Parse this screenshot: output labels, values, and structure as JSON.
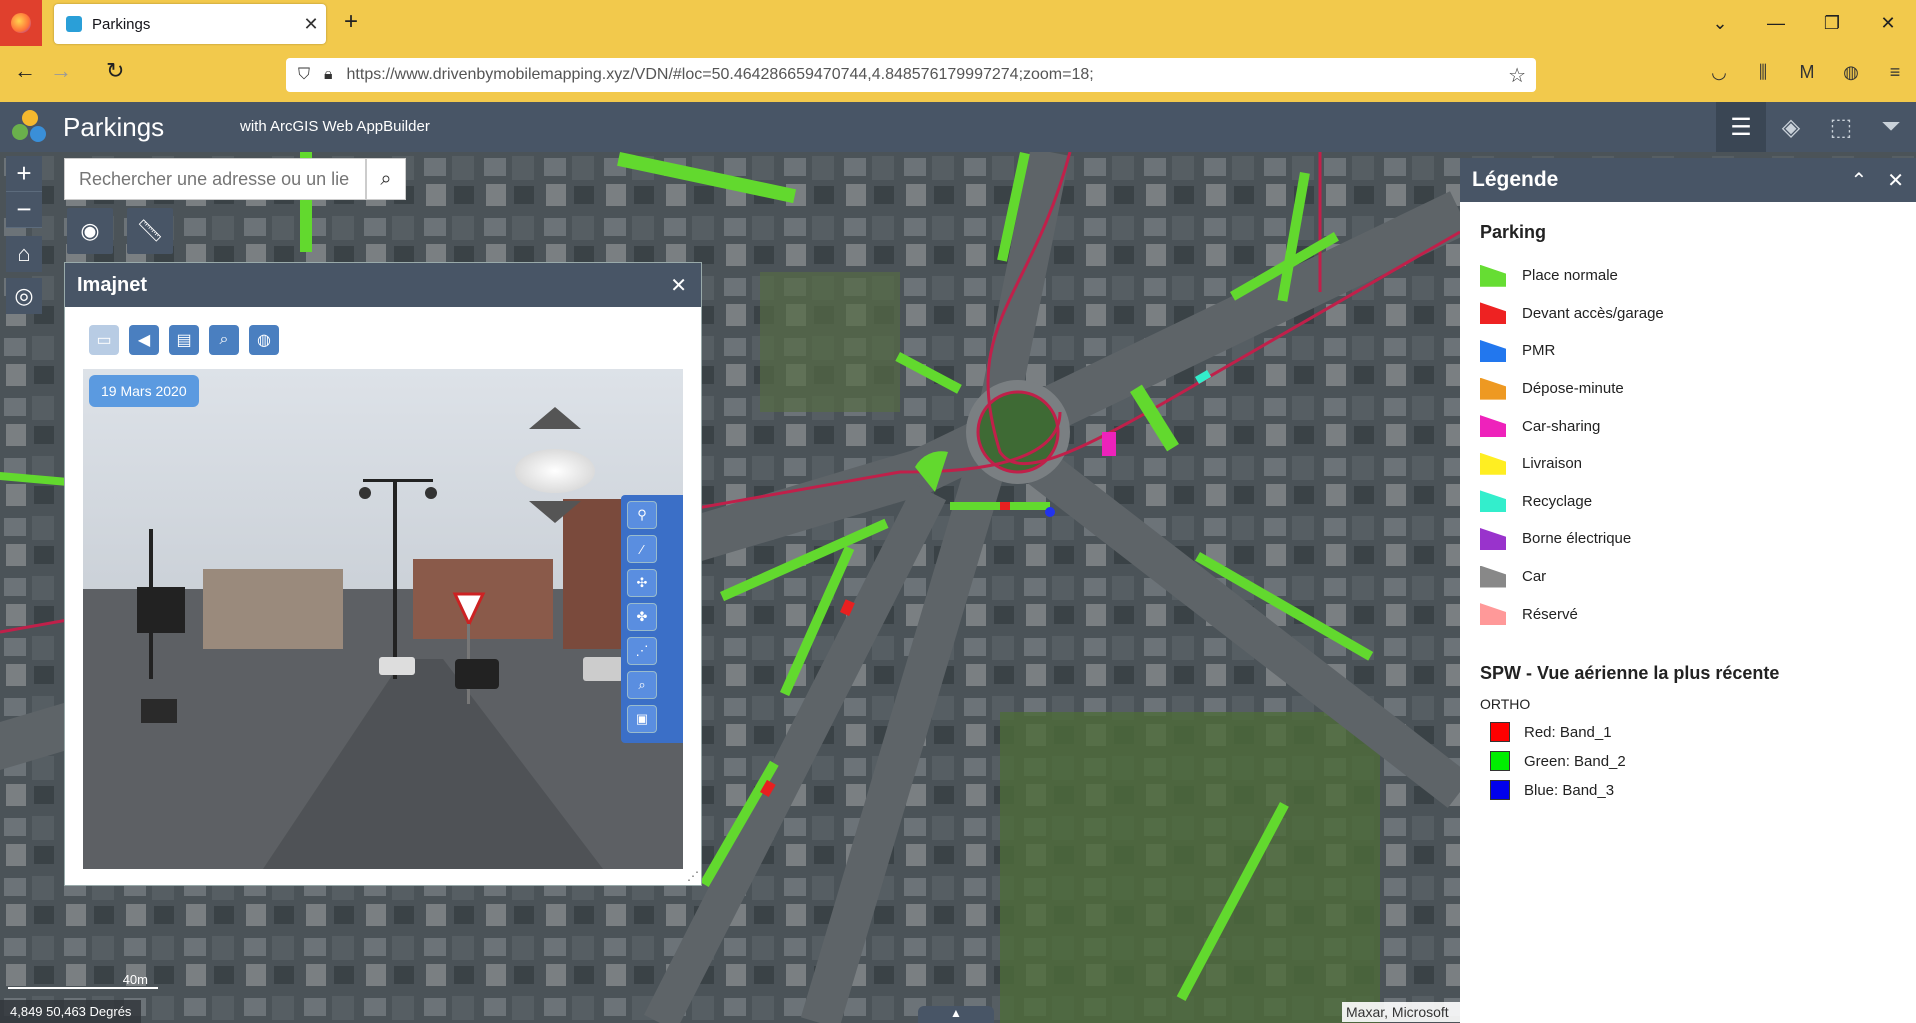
{
  "browser": {
    "tab_title": "Parkings",
    "url": "https://www.drivenbymobilemapping.xyz/VDN/#loc=50.464286659470744,4.848576179997274;zoom=18;"
  },
  "app": {
    "title": "Parkings",
    "subtitle": "with ArcGIS Web AppBuilder"
  },
  "search": {
    "placeholder": "Rechercher une adresse ou un lie"
  },
  "imajnet": {
    "title": "Imajnet",
    "date": "19 Mars 2020"
  },
  "legend": {
    "title": "Légende",
    "section1": "Parking",
    "items": [
      {
        "label": "Place normale",
        "color": "#66dd33"
      },
      {
        "label": "Devant accès/garage",
        "color": "#ee2222"
      },
      {
        "label": "PMR",
        "color": "#2277ee"
      },
      {
        "label": "Dépose-minute",
        "color": "#ee9922"
      },
      {
        "label": "Car-sharing",
        "color": "#ee22bb"
      },
      {
        "label": "Livraison",
        "color": "#ffee22"
      },
      {
        "label": "Recyclage",
        "color": "#33eecc"
      },
      {
        "label": "Borne électrique",
        "color": "#9933cc"
      },
      {
        "label": "Car",
        "color": "#888888"
      },
      {
        "label": "Réservé",
        "color": "#ff9999"
      }
    ],
    "section2": "SPW - Vue aérienne la plus récente",
    "sublabel": "ORTHO",
    "bands": [
      {
        "label": "Red: Band_1",
        "color": "#ff0000"
      },
      {
        "label": "Green: Band_2",
        "color": "#00ee00"
      },
      {
        "label": "Blue: Band_3",
        "color": "#0000ee"
      }
    ]
  },
  "map": {
    "scale_label": "40m",
    "coordinates": "4,849 50,463 Degrés",
    "attribution": "Maxar, Microsoft"
  }
}
